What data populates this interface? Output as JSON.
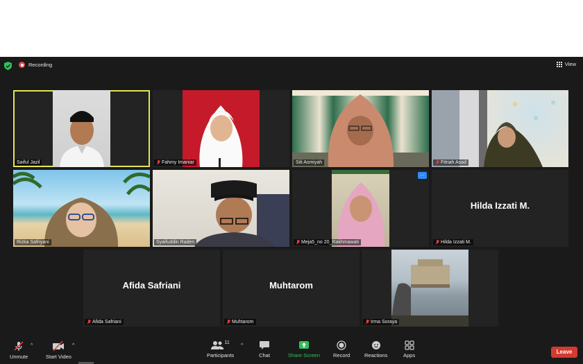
{
  "header": {
    "recording_label": "Recording",
    "view_label": "View"
  },
  "participants": [
    {
      "name": "Saiful Jazil",
      "muted": false
    },
    {
      "name": "Fahmy Imaniar",
      "muted": true
    },
    {
      "name": "Siti Asmiyah",
      "muted": false
    },
    {
      "name": "Fitriah Asad",
      "muted": true
    },
    {
      "name": "Rizka Safriyani",
      "muted": false
    },
    {
      "name": "Syaifuddin Raden",
      "muted": false
    },
    {
      "name": "Meja5_no 20_Rakhmawati",
      "muted": true
    },
    {
      "name": "Hilda Izzati M.",
      "display_name": "Hilda Izzati M.",
      "muted": true
    },
    {
      "name": "Afida Safriani",
      "display_name": "Afida Safriani",
      "muted": true
    },
    {
      "name": "Muhtarom",
      "display_name": "Muhtarom",
      "muted": true
    },
    {
      "name": "Irma Soraya",
      "muted": true
    }
  ],
  "toolbar": {
    "unmute_label": "Unmute",
    "start_video_label": "Start Video",
    "participants_label": "Participants",
    "participants_count": "11",
    "chat_label": "Chat",
    "share_screen_label": "Share Screen",
    "record_label": "Record",
    "reactions_label": "Reactions",
    "apps_label": "Apps",
    "leave_label": "Leave",
    "more_label": "..."
  },
  "colors": {
    "active_speaker": "#e2e655",
    "share_green": "#2fc25b",
    "leave_red": "#d43a2f",
    "muted_red": "#e53c3c"
  }
}
